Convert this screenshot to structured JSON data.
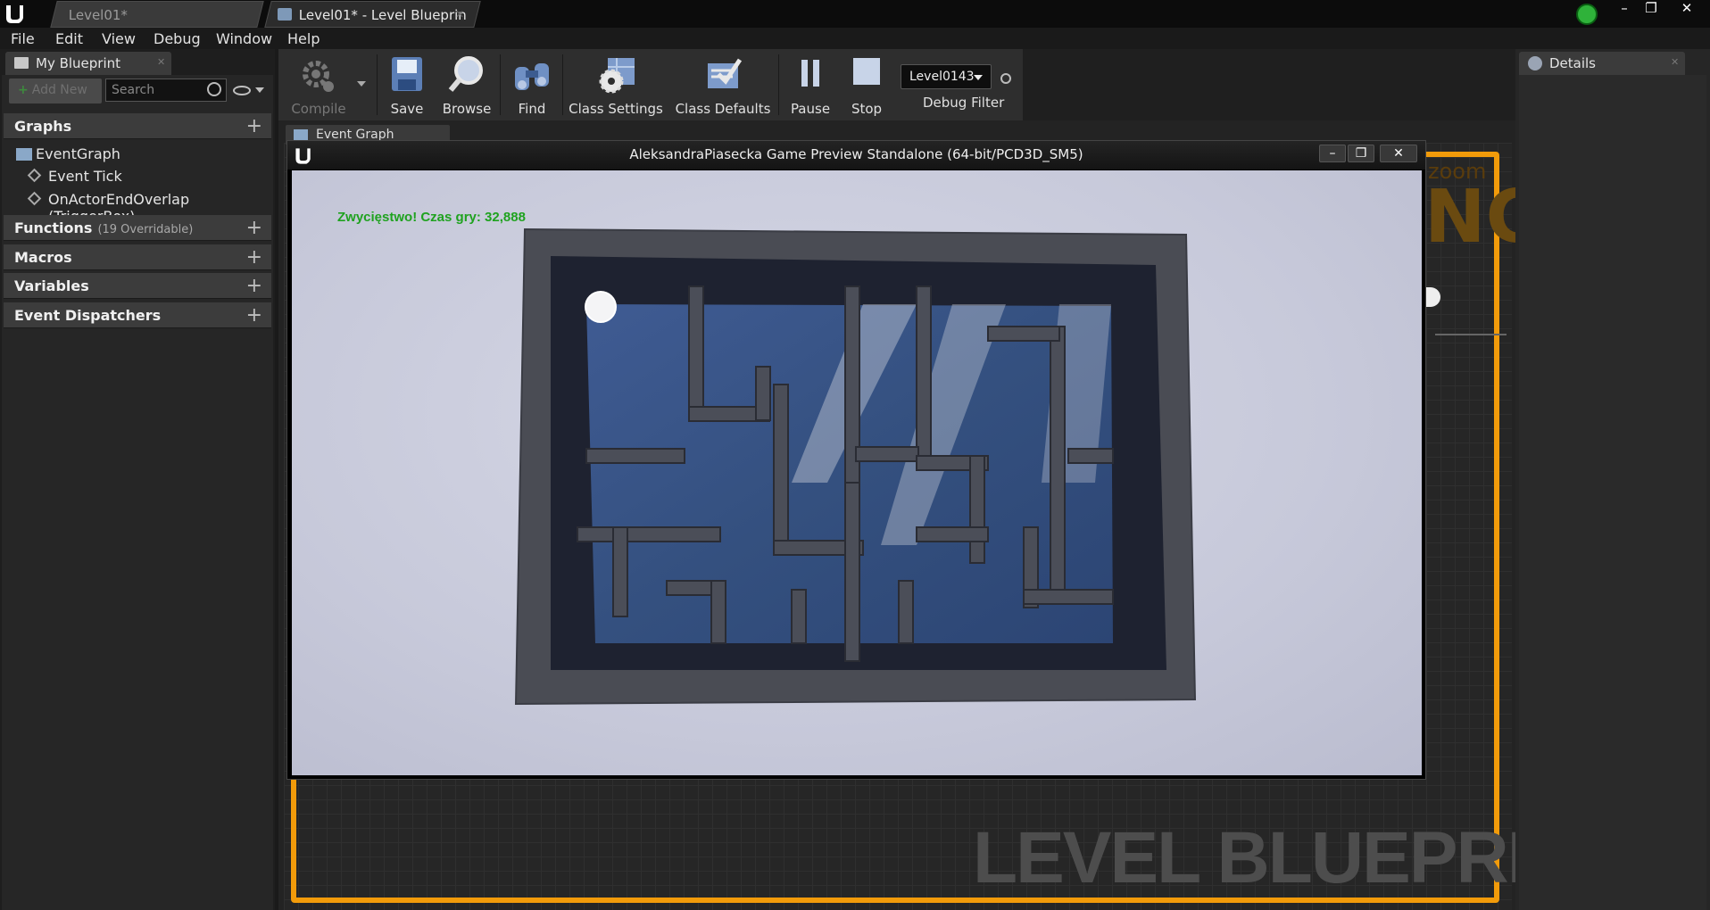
{
  "tabs": [
    {
      "label": "Level01*"
    },
    {
      "label": "Level01* - Level Blueprin"
    }
  ],
  "window_controls": {
    "minimize": "–",
    "restore": "❐",
    "close": "✕"
  },
  "menu": [
    "File",
    "Edit",
    "View",
    "Debug",
    "Window",
    "Help"
  ],
  "my_blueprint": {
    "tab_label": "My Blueprint",
    "add_new": "Add New",
    "search_placeholder": "Search",
    "sections": {
      "graphs": "Graphs",
      "functions": "Functions",
      "functions_sub": "(19 Overridable)",
      "macros": "Macros",
      "variables": "Variables",
      "dispatchers": "Event Dispatchers"
    },
    "graph_items": {
      "event_graph": "EventGraph",
      "event_tick": "Event Tick",
      "overlap": "OnActorEndOverlap (TriggerBox)"
    }
  },
  "toolbar": {
    "compile": "Compile",
    "save": "Save",
    "browse": "Browse",
    "find": "Find",
    "class_settings": "Class Settings",
    "class_defaults": "Class Defaults",
    "pause": "Pause",
    "stop": "Stop",
    "debug_select": "Level0143",
    "debug_filter": "Debug Filter"
  },
  "graph_tab": {
    "label": "Event Graph"
  },
  "canvas": {
    "watermark": "LEVEL BLUEPRINT",
    "zoom_partial": "zoom",
    "ng_partial": "NG"
  },
  "details": {
    "tab_label": "Details"
  },
  "game_window": {
    "title": "AleksandraPiasecka Game Preview Standalone (64-bit/PCD3D_SM5)",
    "win_message": "Zwycięstwo! Czas gry: 32,888"
  },
  "colors": {
    "accent_frame": "#f29b0a",
    "win_text": "#1fa21f"
  }
}
